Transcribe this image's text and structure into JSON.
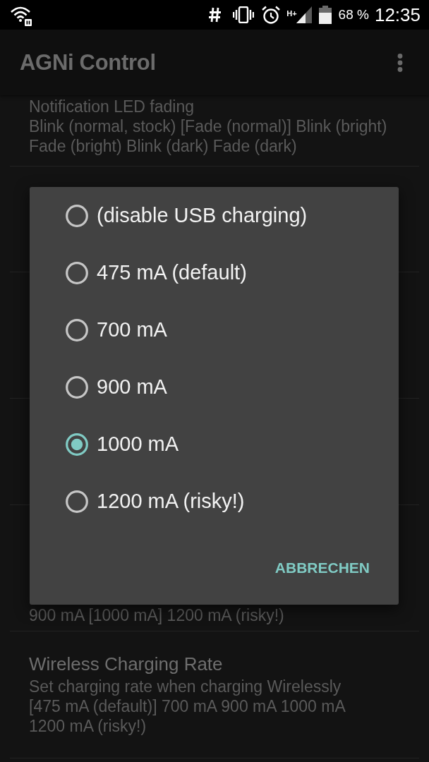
{
  "status_bar": {
    "network_type": "H+",
    "battery": "68 %",
    "time": "12:35"
  },
  "app_bar": {
    "title": "AGNi Control"
  },
  "settings": [
    {
      "summary": "Notification LED fading\nBlink (normal, stock) [Fade (normal)] Blink (bright) Fade (bright) Blink (dark) Fade (dark)"
    },
    {
      "summary": "900 mA [1000 mA] 1200 mA (risky!)"
    },
    {
      "title": "Wireless Charging Rate",
      "summary": "Set charging rate when charging Wirelessly\n[475 mA (default)] 700 mA 900 mA 1000 mA 1200 mA (risky!)"
    }
  ],
  "dialog": {
    "options": [
      {
        "label": "(disable USB charging)",
        "selected": false
      },
      {
        "label": "475 mA (default)",
        "selected": false
      },
      {
        "label": "700 mA",
        "selected": false
      },
      {
        "label": "900 mA",
        "selected": false
      },
      {
        "label": "1000 mA",
        "selected": true
      },
      {
        "label": "1200 mA (risky!)",
        "selected": false
      }
    ],
    "buttons": [
      "ABBRECHEN"
    ]
  }
}
